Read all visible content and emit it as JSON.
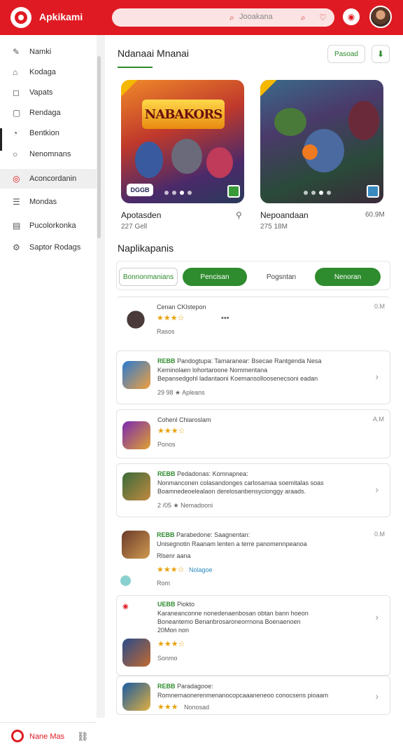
{
  "header": {
    "app_title": "Apkikami",
    "search_placeholder": "Jooakana",
    "icons": [
      "app-logo-icon",
      "search-icon",
      "heart-icon",
      "camera-icon"
    ]
  },
  "sidebar": {
    "items": [
      {
        "label": "Namki",
        "icon": "pencil-icon"
      },
      {
        "label": "Kodaga",
        "icon": "home-icon"
      },
      {
        "label": "Vapats",
        "icon": "bell-icon"
      },
      {
        "label": "Rendaga",
        "icon": "square-icon"
      },
      {
        "label": "Bentkion",
        "icon": "clock-icon"
      },
      {
        "label": "Nenomnans",
        "icon": "circle-icon"
      },
      {
        "label": "Aconcordanin",
        "icon": "target-icon"
      },
      {
        "label": "Mondas",
        "icon": "list-icon"
      },
      {
        "label": "Pucolorkonka",
        "icon": "chart-icon"
      },
      {
        "label": "Saptor Rodags",
        "icon": "settings-icon"
      }
    ],
    "active_index": 6,
    "footer_label": "Nane Mas"
  },
  "featured": {
    "title": "Ndanaai Mnanai",
    "chip_label": "Pasoad",
    "cards": [
      {
        "banner": "NABAKORS",
        "title": "Apotasden",
        "sub": "227 Gell",
        "badge": "DGGB",
        "action_icon": "share-icon"
      },
      {
        "banner": "",
        "title": "Nepoandaan",
        "sub": "275 18M",
        "badge": "",
        "size": "60.9M"
      }
    ]
  },
  "apps_section": {
    "title": "Naplikapanis",
    "filters": [
      {
        "label": "Bonnonmanians",
        "style": "outline"
      },
      {
        "label": "Pencisan",
        "style": "green"
      },
      {
        "label": "Pogsntan",
        "style": "plain"
      },
      {
        "label": "Nenoran",
        "style": "green"
      }
    ]
  },
  "list": [
    {
      "title": "Cenan CKlstepon",
      "sub": "Rasos",
      "time": "0.M",
      "rating": "★★★☆",
      "extra": "•••"
    },
    {
      "tag": "REBB",
      "title": "Pandogtupa:",
      "lines": [
        "Tamaranear: Bsecae Rantgenda Nesa",
        "Keminolaen lohortaroone Nommentana",
        "Bepansedgohl ladantaoni Koemansolloosenecsoni eadan"
      ],
      "meta": "29 98 ★ Apleans"
    },
    {
      "title": "Cohenl Chiaroslam",
      "sub": "Ponos",
      "time": "A.M",
      "rating": "★★★☆"
    },
    {
      "tag": "REBB",
      "title": "Pedadonas:",
      "lines": [
        "Komnapnea:",
        "Nonmanconen colasandonges carlosamaa soemitalas soas",
        "Boamnedeoelealaon derelosanbensycionggy araads."
      ],
      "meta": "2 /05 ★ Nemadooni"
    },
    {
      "tag": "REBB",
      "title": "Parabedone:",
      "sub2": "Saagnentan:",
      "lines": [
        "Unisegnotin Raanam lenten a terre panomennpeanoa",
        "Rlsenr aana"
      ],
      "meta": "Nolagoe",
      "rating": "★★★☆",
      "time": "0.M",
      "footer": "Rom"
    },
    {
      "tag": "UEBB",
      "title": "Piokto",
      "lines": [
        "Karaneanconne nonedenaenbosan obtan bann hoeon",
        "Boneantemo Benanbrosaroneorrnona Boenaenoen",
        "20Mon non"
      ],
      "meta": "Sonmo",
      "rating": "★★★☆"
    },
    {
      "tag": "REBB",
      "title": "Paradagooe:",
      "lines": [
        "Romnernaonerenmenanocopcaaaneneoo conocsens pioaam"
      ],
      "meta": "Nonosad",
      "rating": "★★★"
    }
  ]
}
